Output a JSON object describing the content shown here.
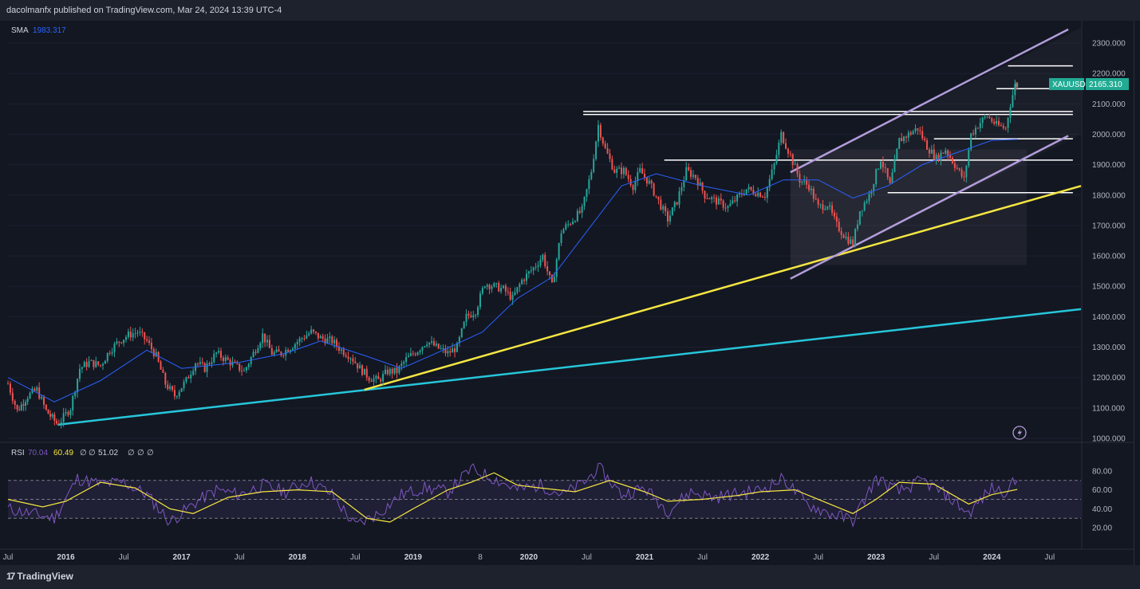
{
  "header": {
    "publish_text": "dacolmanfx published on TradingView.com, Mar 24, 2024 13:39 UTC-4"
  },
  "footer": {
    "brand": "TradingView"
  },
  "price_panel": {
    "sma_label": "SMA",
    "sma_value": "1983.317",
    "symbol_tag": "XAUUSD",
    "price_tag": "2165.310",
    "colors": {
      "sma": "#2962ff",
      "up": "#26a69a",
      "down": "#ef5350",
      "channel": "#b39ddb",
      "support": "#f5e642",
      "long_trend": "#26c6da",
      "tag": "#22ab94"
    }
  },
  "rsi_panel": {
    "label": "RSI",
    "value1": "70.04",
    "value2": "60.49",
    "value3": "51.02",
    "dots": [
      "∅",
      "∅",
      "∅",
      "∅",
      "∅"
    ],
    "colors": {
      "rsi": "#7e57c2",
      "ma": "#f5e642"
    }
  },
  "chart_data": {
    "type": "candlestick",
    "symbol": "XAUUSD",
    "x_ticks": [
      "Jul",
      "2016",
      "Jul",
      "2017",
      "Jul",
      "2018",
      "Jul",
      "2019",
      "8",
      "2020",
      "Jul",
      "2021",
      "Jul",
      "2022",
      "Jul",
      "2023",
      "Jul",
      "2024",
      "Jul"
    ],
    "x_tick_dates": [
      2015.5,
      2016.0,
      2016.5,
      2017.0,
      2017.5,
      2018.0,
      2018.5,
      2019.0,
      2019.58,
      2020.0,
      2020.5,
      2021.0,
      2021.5,
      2022.0,
      2022.5,
      2023.0,
      2023.5,
      2024.0,
      2024.5
    ],
    "x_range": [
      2015.5,
      2024.77
    ],
    "y_ticks": [
      "2300.000",
      "2200.000",
      "2100.000",
      "2000.000",
      "1900.000",
      "1800.000",
      "1700.000",
      "1600.000",
      "1500.000",
      "1400.000",
      "1300.000",
      "1200.000",
      "1100.000",
      "1000.000"
    ],
    "ylim": [
      1000,
      2300
    ],
    "weekly_close": [
      [
        2015.5,
        1180
      ],
      [
        2015.58,
        1090
      ],
      [
        2015.67,
        1140
      ],
      [
        2015.75,
        1160
      ],
      [
        2015.83,
        1090
      ],
      [
        2015.92,
        1050
      ],
      [
        2015.96,
        1060
      ],
      [
        2016.04,
        1100
      ],
      [
        2016.12,
        1230
      ],
      [
        2016.2,
        1250
      ],
      [
        2016.3,
        1240
      ],
      [
        2016.38,
        1290
      ],
      [
        2016.46,
        1320
      ],
      [
        2016.54,
        1340
      ],
      [
        2016.62,
        1350
      ],
      [
        2016.7,
        1320
      ],
      [
        2016.78,
        1270
      ],
      [
        2016.86,
        1180
      ],
      [
        2016.94,
        1140
      ],
      [
        2017.04,
        1190
      ],
      [
        2017.12,
        1250
      ],
      [
        2017.2,
        1230
      ],
      [
        2017.3,
        1280
      ],
      [
        2017.38,
        1260
      ],
      [
        2017.46,
        1240
      ],
      [
        2017.54,
        1220
      ],
      [
        2017.62,
        1280
      ],
      [
        2017.7,
        1340
      ],
      [
        2017.78,
        1280
      ],
      [
        2017.86,
        1280
      ],
      [
        2017.94,
        1300
      ],
      [
        2018.04,
        1330
      ],
      [
        2018.12,
        1350
      ],
      [
        2018.2,
        1330
      ],
      [
        2018.3,
        1320
      ],
      [
        2018.38,
        1290
      ],
      [
        2018.46,
        1270
      ],
      [
        2018.54,
        1230
      ],
      [
        2018.62,
        1200
      ],
      [
        2018.7,
        1190
      ],
      [
        2018.78,
        1220
      ],
      [
        2018.86,
        1220
      ],
      [
        2018.94,
        1260
      ],
      [
        2019.04,
        1290
      ],
      [
        2019.12,
        1320
      ],
      [
        2019.2,
        1300
      ],
      [
        2019.3,
        1280
      ],
      [
        2019.38,
        1300
      ],
      [
        2019.46,
        1400
      ],
      [
        2019.54,
        1420
      ],
      [
        2019.62,
        1510
      ],
      [
        2019.7,
        1500
      ],
      [
        2019.78,
        1490
      ],
      [
        2019.86,
        1460
      ],
      [
        2019.94,
        1520
      ],
      [
        2020.04,
        1560
      ],
      [
        2020.12,
        1600
      ],
      [
        2020.2,
        1500
      ],
      [
        2020.28,
        1680
      ],
      [
        2020.38,
        1720
      ],
      [
        2020.46,
        1750
      ],
      [
        2020.54,
        1880
      ],
      [
        2020.6,
        2030
      ],
      [
        2020.66,
        1950
      ],
      [
        2020.74,
        1880
      ],
      [
        2020.82,
        1880
      ],
      [
        2020.9,
        1830
      ],
      [
        2020.96,
        1880
      ],
      [
        2021.04,
        1840
      ],
      [
        2021.12,
        1780
      ],
      [
        2021.2,
        1720
      ],
      [
        2021.28,
        1780
      ],
      [
        2021.36,
        1880
      ],
      [
        2021.44,
        1860
      ],
      [
        2021.52,
        1800
      ],
      [
        2021.62,
        1780
      ],
      [
        2021.72,
        1760
      ],
      [
        2021.8,
        1790
      ],
      [
        2021.88,
        1820
      ],
      [
        2021.96,
        1810
      ],
      [
        2022.04,
        1800
      ],
      [
        2022.12,
        1900
      ],
      [
        2022.18,
        2000
      ],
      [
        2022.26,
        1930
      ],
      [
        2022.34,
        1850
      ],
      [
        2022.42,
        1830
      ],
      [
        2022.5,
        1760
      ],
      [
        2022.58,
        1770
      ],
      [
        2022.66,
        1700
      ],
      [
        2022.74,
        1660
      ],
      [
        2022.8,
        1640
      ],
      [
        2022.86,
        1750
      ],
      [
        2022.94,
        1800
      ],
      [
        2023.04,
        1920
      ],
      [
        2023.12,
        1830
      ],
      [
        2023.2,
        1980
      ],
      [
        2023.28,
        2000
      ],
      [
        2023.36,
        2020
      ],
      [
        2023.44,
        1960
      ],
      [
        2023.52,
        1920
      ],
      [
        2023.6,
        1950
      ],
      [
        2023.68,
        1900
      ],
      [
        2023.76,
        1850
      ],
      [
        2023.82,
        2000
      ],
      [
        2023.9,
        2040
      ],
      [
        2023.96,
        2060
      ],
      [
        2024.04,
        2030
      ],
      [
        2024.12,
        2020
      ],
      [
        2024.16,
        2100
      ],
      [
        2024.2,
        2160
      ],
      [
        2024.22,
        2165.31
      ]
    ],
    "sma_points": [
      [
        2015.5,
        1200
      ],
      [
        2015.9,
        1120
      ],
      [
        2016.3,
        1190
      ],
      [
        2016.7,
        1290
      ],
      [
        2017.0,
        1230
      ],
      [
        2017.5,
        1250
      ],
      [
        2017.9,
        1280
      ],
      [
        2018.2,
        1320
      ],
      [
        2018.6,
        1270
      ],
      [
        2018.9,
        1230
      ],
      [
        2019.2,
        1280
      ],
      [
        2019.6,
        1350
      ],
      [
        2019.9,
        1460
      ],
      [
        2020.2,
        1530
      ],
      [
        2020.5,
        1680
      ],
      [
        2020.8,
        1830
      ],
      [
        2021.1,
        1870
      ],
      [
        2021.5,
        1830
      ],
      [
        2021.9,
        1800
      ],
      [
        2022.2,
        1850
      ],
      [
        2022.5,
        1850
      ],
      [
        2022.8,
        1790
      ],
      [
        2023.1,
        1830
      ],
      [
        2023.4,
        1900
      ],
      [
        2023.7,
        1940
      ],
      [
        2024.0,
        1980
      ],
      [
        2024.22,
        1983.317
      ]
    ],
    "rsi_series": {
      "ticks": [
        "80.00",
        "60.00",
        "40.00",
        "20.00"
      ],
      "ylim": [
        10,
        90
      ],
      "bands": [
        70,
        50,
        30
      ],
      "rsi_points": [
        [
          2015.5,
          40
        ],
        [
          2015.7,
          35
        ],
        [
          2015.9,
          30
        ],
        [
          2016.1,
          72
        ],
        [
          2016.3,
          66
        ],
        [
          2016.5,
          68
        ],
        [
          2016.7,
          55
        ],
        [
          2016.9,
          26
        ],
        [
          2017.1,
          45
        ],
        [
          2017.3,
          60
        ],
        [
          2017.5,
          55
        ],
        [
          2017.7,
          65
        ],
        [
          2017.9,
          58
        ],
        [
          2018.1,
          70
        ],
        [
          2018.3,
          55
        ],
        [
          2018.5,
          22
        ],
        [
          2018.7,
          35
        ],
        [
          2018.9,
          55
        ],
        [
          2019.1,
          62
        ],
        [
          2019.3,
          58
        ],
        [
          2019.5,
          82
        ],
        [
          2019.7,
          72
        ],
        [
          2019.9,
          60
        ],
        [
          2020.1,
          65
        ],
        [
          2020.3,
          55
        ],
        [
          2020.5,
          70
        ],
        [
          2020.6,
          84
        ],
        [
          2020.8,
          55
        ],
        [
          2021.0,
          62
        ],
        [
          2021.2,
          38
        ],
        [
          2021.4,
          58
        ],
        [
          2021.6,
          52
        ],
        [
          2021.8,
          56
        ],
        [
          2022.0,
          60
        ],
        [
          2022.2,
          72
        ],
        [
          2022.4,
          45
        ],
        [
          2022.6,
          35
        ],
        [
          2022.8,
          28
        ],
        [
          2023.0,
          72
        ],
        [
          2023.2,
          58
        ],
        [
          2023.4,
          70
        ],
        [
          2023.6,
          55
        ],
        [
          2023.8,
          35
        ],
        [
          2024.0,
          62
        ],
        [
          2024.1,
          58
        ],
        [
          2024.22,
          70.04
        ]
      ],
      "ma_points": [
        [
          2015.5,
          50
        ],
        [
          2015.8,
          42
        ],
        [
          2016.0,
          48
        ],
        [
          2016.3,
          68
        ],
        [
          2016.6,
          62
        ],
        [
          2016.9,
          40
        ],
        [
          2017.1,
          35
        ],
        [
          2017.4,
          52
        ],
        [
          2017.7,
          58
        ],
        [
          2018.0,
          60
        ],
        [
          2018.3,
          58
        ],
        [
          2018.6,
          30
        ],
        [
          2018.8,
          26
        ],
        [
          2019.0,
          40
        ],
        [
          2019.3,
          60
        ],
        [
          2019.5,
          68
        ],
        [
          2019.7,
          78
        ],
        [
          2019.9,
          65
        ],
        [
          2020.1,
          62
        ],
        [
          2020.4,
          58
        ],
        [
          2020.7,
          70
        ],
        [
          2021.0,
          58
        ],
        [
          2021.2,
          48
        ],
        [
          2021.5,
          50
        ],
        [
          2021.8,
          54
        ],
        [
          2022.0,
          58
        ],
        [
          2022.3,
          60
        ],
        [
          2022.6,
          45
        ],
        [
          2022.8,
          35
        ],
        [
          2023.0,
          50
        ],
        [
          2023.2,
          68
        ],
        [
          2023.5,
          66
        ],
        [
          2023.8,
          45
        ],
        [
          2024.0,
          55
        ],
        [
          2024.22,
          60.49
        ]
      ]
    }
  }
}
